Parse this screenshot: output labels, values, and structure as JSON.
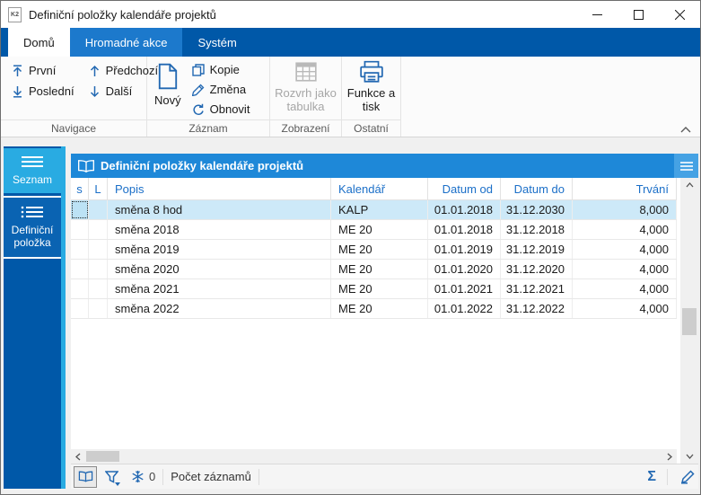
{
  "window": {
    "title": "Definiční položky kalendáře projektů",
    "app_icon_label": "K2"
  },
  "ribbon": {
    "tabs": [
      {
        "label": "Domů",
        "active": true
      },
      {
        "label": "Hromadné akce",
        "active": false
      },
      {
        "label": "Systém",
        "active": false
      }
    ],
    "navigace": {
      "caption": "Navigace",
      "prvni": "První",
      "posledni": "Poslední",
      "predchozi": "Předchozí",
      "dalsi": "Další"
    },
    "zaznam": {
      "caption": "Záznam",
      "novy": "Nový",
      "kopie": "Kopie",
      "zmena": "Změna",
      "obnovit": "Obnovit"
    },
    "zobrazeni": {
      "caption": "Zobrazení",
      "rozvrh": "Rozvrh jako tabulka",
      "rozvrh_disabled": true
    },
    "ostatni": {
      "caption": "Ostatní",
      "funkce": "Funkce a tisk"
    }
  },
  "sidebar": {
    "items": [
      {
        "label": "Seznam",
        "active": true
      },
      {
        "label": "Definiční položka",
        "active": false
      }
    ]
  },
  "panel": {
    "title": "Definiční položky kalendáře projektů"
  },
  "table": {
    "columns": {
      "s": "s",
      "l": "L",
      "popis": "Popis",
      "kalendar": "Kalendář",
      "datum_od": "Datum od",
      "datum_do": "Datum do",
      "trvani": "Trvání"
    },
    "rows": [
      {
        "s": "",
        "l": "",
        "popis": "směna 8 hod",
        "kalendar": "KALP",
        "datum_od": "01.01.2018",
        "datum_do": "31.12.2030",
        "trvani": "8,000",
        "selected": true
      },
      {
        "s": "",
        "l": "",
        "popis": "směna 2018",
        "kalendar": "ME 20",
        "datum_od": "01.01.2018",
        "datum_do": "31.12.2018",
        "trvani": "4,000",
        "selected": false
      },
      {
        "s": "",
        "l": "",
        "popis": "směna 2019",
        "kalendar": "ME 20",
        "datum_od": "01.01.2019",
        "datum_do": "31.12.2019",
        "trvani": "4,000",
        "selected": false
      },
      {
        "s": "",
        "l": "",
        "popis": "směna 2020",
        "kalendar": "ME 20",
        "datum_od": "01.01.2020",
        "datum_do": "31.12.2020",
        "trvani": "4,000",
        "selected": false
      },
      {
        "s": "",
        "l": "",
        "popis": "směna 2021",
        "kalendar": "ME 20",
        "datum_od": "01.01.2021",
        "datum_do": "31.12.2021",
        "trvani": "4,000",
        "selected": false
      },
      {
        "s": "",
        "l": "",
        "popis": "směna 2022",
        "kalendar": "ME 20",
        "datum_od": "01.01.2022",
        "datum_do": "31.12.2022",
        "trvani": "4,000",
        "selected": false
      }
    ]
  },
  "statusbar": {
    "filter_count": "0",
    "count_label": "Počet záznamů",
    "sigma": "Σ"
  },
  "colors": {
    "accent_dark_blue": "#0058A8",
    "accent_cyan": "#29ABE2",
    "tab_highlight_blue": "#1C79CC",
    "panel_header_blue": "#1E88D8",
    "selected_row": "#CDE9F8",
    "icon_blue": "#2268B2",
    "column_header_text": "#1B6FC8",
    "disabled_gray": "#A6A6A6"
  }
}
